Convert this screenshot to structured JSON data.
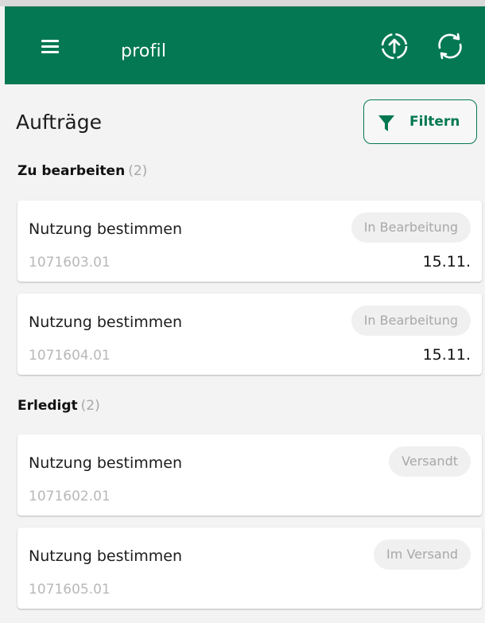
{
  "appbar": {
    "title": "profil",
    "menu_icon": "hamburger-menu-icon",
    "upload_icon": "upload-circle-icon",
    "sync_icon": "sync-icon",
    "color": "#047852"
  },
  "header": {
    "title": "Aufträge",
    "filter_label": "Filtern",
    "filter_icon": "funnel-icon"
  },
  "sections": [
    {
      "label": "Zu bearbeiten",
      "count": "(2)",
      "items": [
        {
          "title": "Nutzung bestimmen",
          "id": "1071603.01",
          "status": "In Bearbeitung",
          "date": "15.11."
        },
        {
          "title": "Nutzung bestimmen",
          "id": "1071604.01",
          "status": "In Bearbeitung",
          "date": "15.11."
        }
      ]
    },
    {
      "label": "Erledigt",
      "count": "(2)",
      "items": [
        {
          "title": "Nutzung bestimmen",
          "id": "1071602.01",
          "status": "Versandt"
        },
        {
          "title": "Nutzung bestimmen",
          "id": "1071605.01",
          "status": "Im Versand"
        }
      ]
    }
  ]
}
